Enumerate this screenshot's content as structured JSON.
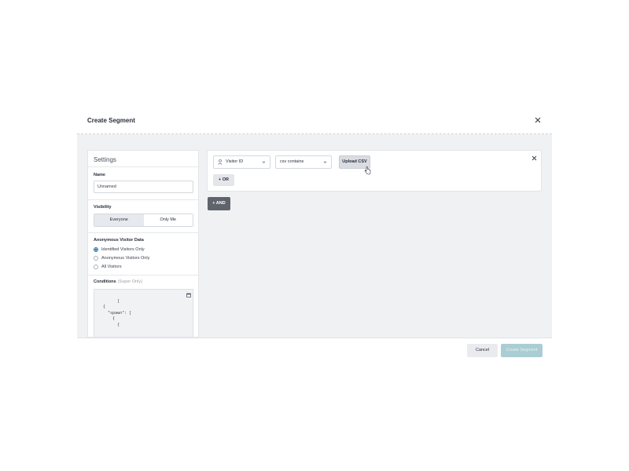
{
  "modal": {
    "title": "Create Segment",
    "close_icon": "close-icon"
  },
  "settings": {
    "title": "Settings",
    "name_label": "Name",
    "name_value": "Unnamed",
    "visibility_label": "Visibility",
    "visibility_options": [
      "Everyone",
      "Only Me"
    ],
    "visibility_selected": "Everyone",
    "anon_label": "Anonymous Visitor Data",
    "anon_options": [
      "Identified Visitors Only",
      "Anonymous Visitors Only",
      "All Visitors"
    ],
    "anon_selected": "Identified Visitors Only",
    "conditions_label": "Conditions",
    "conditions_note": "(Super Only)",
    "conditions_code": "[\n  {\n    \"spawn\": [\n      {\n        {"
  },
  "rule": {
    "field": "Visitor ID",
    "field_icon": "user-icon",
    "operator": "csv contains",
    "upload_label": "Upload CSV",
    "or_label": "+ OR",
    "and_label": "+ AND"
  },
  "footer": {
    "cancel_label": "Cancel",
    "create_label": "Create Segment"
  },
  "colors": {
    "accent": "#2c6fa8",
    "create_disabled": "#a9cdd2",
    "and_button": "#5e636c"
  }
}
